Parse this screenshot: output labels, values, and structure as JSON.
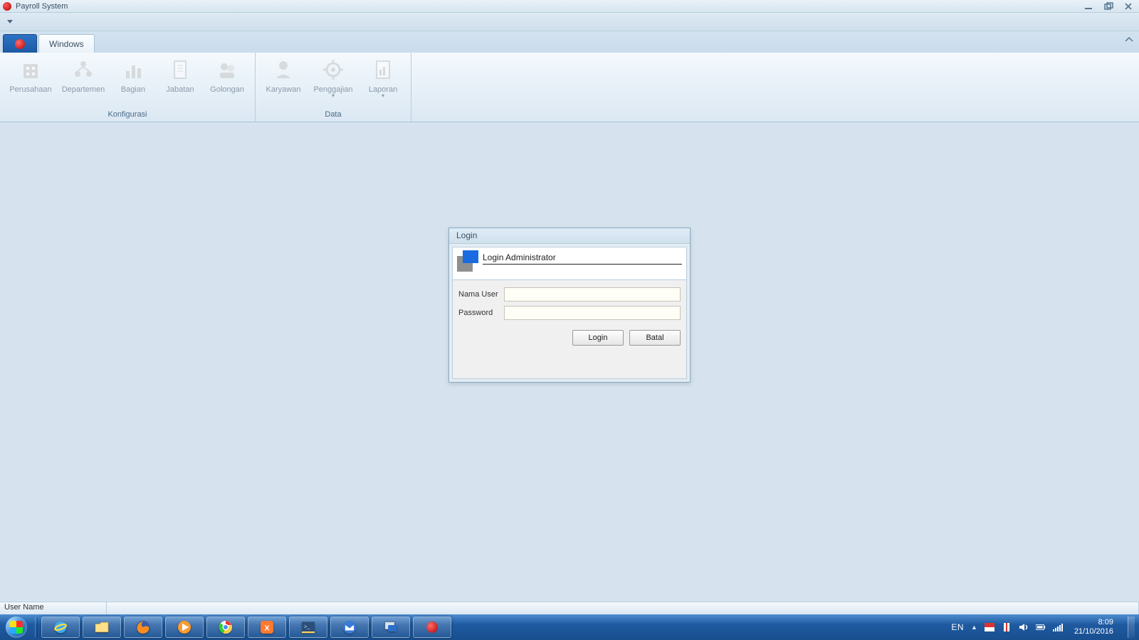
{
  "window": {
    "title": "Payroll System"
  },
  "ribbon": {
    "active_tab": "Windows",
    "groups": {
      "konfigurasi": {
        "label": "Konfigurasi",
        "items": {
          "perusahaan": "Perusahaan",
          "departemen": "Departemen",
          "bagian": "Bagian",
          "jabatan": "Jabatan",
          "golongan": "Golongan"
        }
      },
      "data": {
        "label": "Data",
        "items": {
          "karyawan": "Karyawan",
          "penggajian": "Penggajian",
          "laporan": "Laporan"
        }
      }
    }
  },
  "login": {
    "window_title": "Login",
    "header": "Login Administrator",
    "labels": {
      "username": "Nama User",
      "password": "Password"
    },
    "values": {
      "username": "",
      "password": ""
    },
    "buttons": {
      "login": "Login",
      "cancel": "Batal"
    }
  },
  "statusbar": {
    "username_label": "User Name"
  },
  "system": {
    "lang": "EN",
    "time": "8:09",
    "date": "21/10/2016"
  }
}
